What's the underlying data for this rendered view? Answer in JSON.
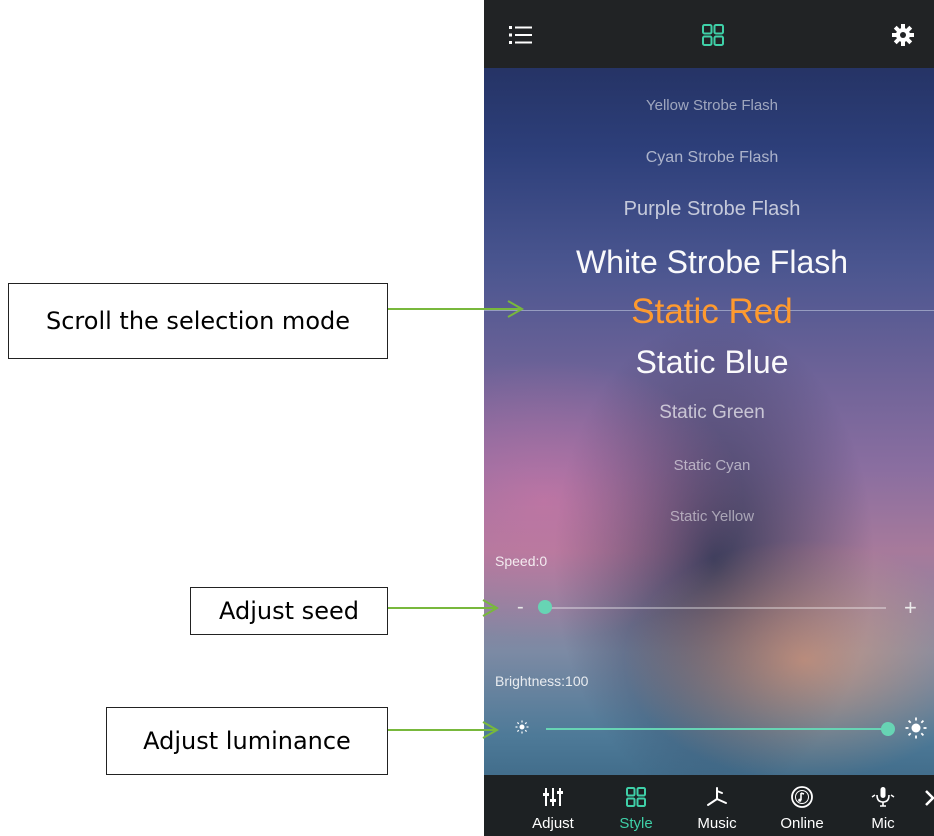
{
  "annotations": {
    "scroll": "Scroll the selection mode",
    "speed": "Adjust seed",
    "brightness": "Adjust luminance"
  },
  "modes": [
    "Yellow Strobe Flash",
    "Cyan Strobe Flash",
    "Purple Strobe Flash",
    "White Strobe Flash",
    "Static Red",
    "Static Blue",
    "Static Green",
    "Static Cyan",
    "Static Yellow"
  ],
  "selected_mode_index": 4,
  "speed": {
    "label": "Speed:0",
    "value": 0,
    "max": 100,
    "minus": "-",
    "plus": "+"
  },
  "brightness": {
    "label": "Brightness:100",
    "value": 100,
    "max": 100
  },
  "tabs": [
    {
      "label": "Adjust",
      "icon": "sliders-icon"
    },
    {
      "label": "Style",
      "icon": "grid-icon",
      "active": true
    },
    {
      "label": "Music",
      "icon": "music-icon"
    },
    {
      "label": "Online",
      "icon": "online-music-icon"
    },
    {
      "label": "Mic",
      "icon": "mic-icon"
    }
  ],
  "colors": {
    "accent": "#3fd0a8",
    "selected_mode": "#ff9a2e",
    "topbar": "#212325",
    "bottombar": "#1d2123",
    "arrow": "#78b83c"
  }
}
